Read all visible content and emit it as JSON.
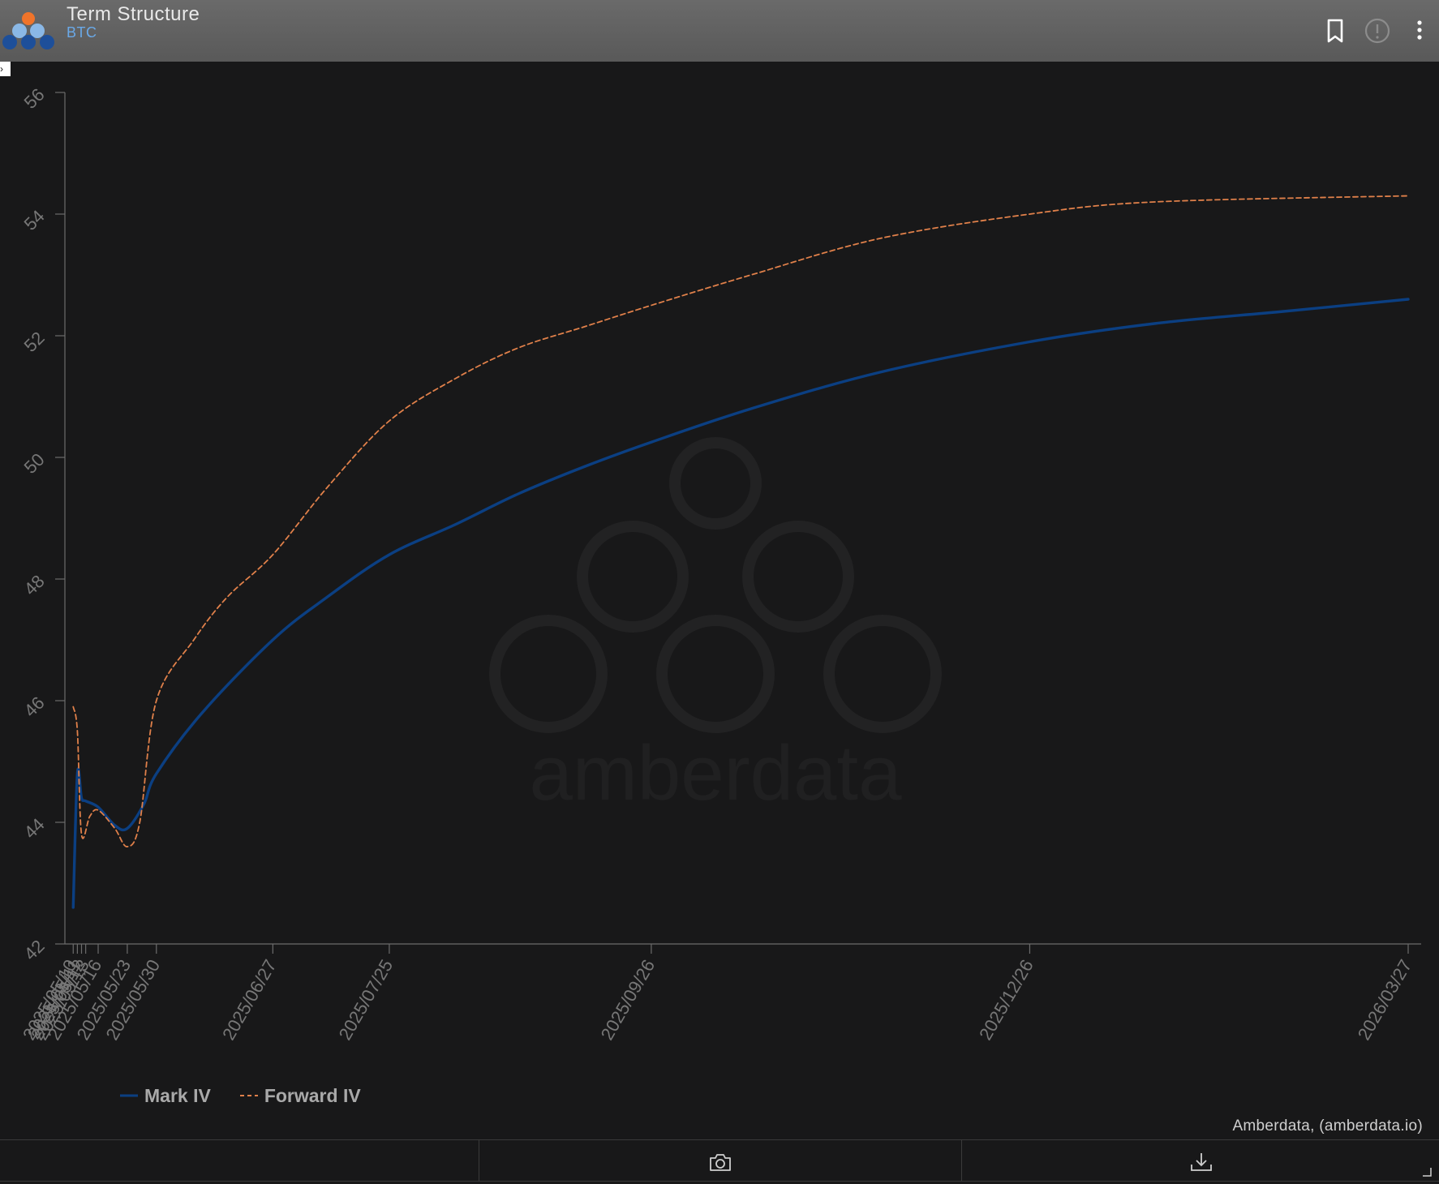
{
  "header": {
    "title": "Term Structure",
    "subtitle": "BTC",
    "icons": [
      "logo-icon",
      "bookmark-icon",
      "info-icon",
      "more-vertical-icon"
    ]
  },
  "colors": {
    "mark_iv": "#0b3f82",
    "forward_iv": "#e0804a",
    "background": "#181819",
    "axis": "#6c6c6c"
  },
  "chart_data": {
    "type": "line",
    "xlabel": "",
    "ylabel": "",
    "ylim": [
      42,
      56
    ],
    "yticks": [
      42,
      44,
      46,
      48,
      50,
      52,
      54,
      56
    ],
    "xticks": [
      "2025/05/10",
      "2025/05/11",
      "2025/05/12",
      "2025/05/13",
      "2025/05/16",
      "2025/05/23",
      "2025/05/30",
      "2025/06/27",
      "2025/07/25",
      "2025/09/26",
      "2025/12/26",
      "2026/03/27"
    ],
    "legend_position": "bottom-left",
    "grid": false,
    "series": [
      {
        "name": "Mark IV",
        "style": "solid",
        "points": [
          [
            "2025/05/10",
            42.6
          ],
          [
            "2025/05/11",
            44.8
          ],
          [
            "2025/05/12",
            44.4
          ],
          [
            "2025/05/13",
            44.35
          ],
          [
            "2025/05/16",
            44.25
          ],
          [
            "2025/05/20",
            43.95
          ],
          [
            "2025/05/23",
            43.9
          ],
          [
            "2025/05/27",
            44.3
          ],
          [
            "2025/05/30",
            44.8
          ],
          [
            "2025/06/10",
            45.8
          ],
          [
            "2025/06/27",
            47.0
          ],
          [
            "2025/07/10",
            47.7
          ],
          [
            "2025/07/25",
            48.4
          ],
          [
            "2025/08/10",
            48.9
          ],
          [
            "2025/08/25",
            49.4
          ],
          [
            "2025/09/10",
            49.85
          ],
          [
            "2025/09/26",
            50.25
          ],
          [
            "2025/10/20",
            50.8
          ],
          [
            "2025/11/20",
            51.4
          ],
          [
            "2025/12/26",
            51.9
          ],
          [
            "2026/01/25",
            52.2
          ],
          [
            "2026/02/25",
            52.4
          ],
          [
            "2026/03/27",
            52.6
          ]
        ]
      },
      {
        "name": "Forward IV",
        "style": "dashed",
        "points": [
          [
            "2025/05/10",
            45.9
          ],
          [
            "2025/05/11",
            45.5
          ],
          [
            "2025/05/12",
            43.8
          ],
          [
            "2025/05/14",
            44.1
          ],
          [
            "2025/05/16",
            44.2
          ],
          [
            "2025/05/20",
            43.9
          ],
          [
            "2025/05/23",
            43.6
          ],
          [
            "2025/05/26",
            44.0
          ],
          [
            "2025/05/30",
            46.0
          ],
          [
            "2025/06/08",
            47.0
          ],
          [
            "2025/06/16",
            47.7
          ],
          [
            "2025/06/27",
            48.4
          ],
          [
            "2025/07/10",
            49.5
          ],
          [
            "2025/07/25",
            50.6
          ],
          [
            "2025/08/10",
            51.3
          ],
          [
            "2025/08/25",
            51.8
          ],
          [
            "2025/09/10",
            52.15
          ],
          [
            "2025/09/26",
            52.5
          ],
          [
            "2025/10/20",
            53.0
          ],
          [
            "2025/11/20",
            53.6
          ],
          [
            "2025/12/26",
            54.0
          ],
          [
            "2026/01/25",
            54.2
          ],
          [
            "2026/03/27",
            54.3
          ]
        ]
      }
    ]
  },
  "legend": [
    {
      "label": "Mark IV"
    },
    {
      "label": "Forward IV"
    }
  ],
  "credit": "Amberdata, (amberdata.io)",
  "footer": {
    "icons": [
      "camera-icon",
      "download-icon"
    ]
  }
}
